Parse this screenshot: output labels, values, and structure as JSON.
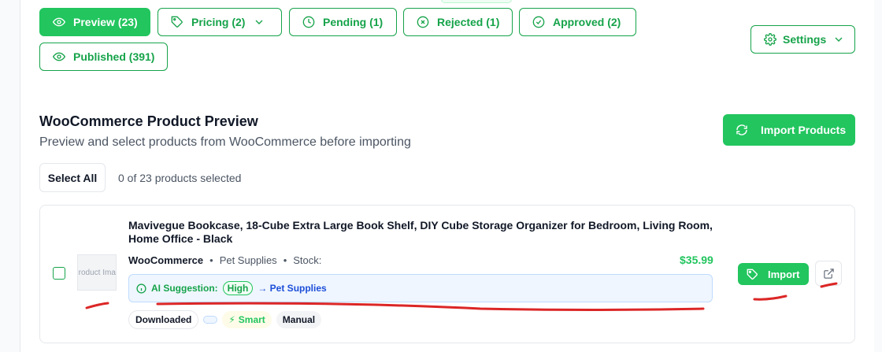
{
  "filters": {
    "preview": "Preview (23)",
    "pricing": "Pricing (2)",
    "pending": "Pending (1)",
    "rejected": "Rejected (1)",
    "approved": "Approved (2)",
    "published": "Published (391)"
  },
  "settings_label": "Settings",
  "section": {
    "title": "WooCommerce Product Preview",
    "subtitle": "Preview and select products from WooCommerce before importing",
    "import_all_label": "Import Products",
    "select_all_label": "Select All",
    "selection_status": "0 of 23 products selected"
  },
  "product": {
    "title": "Mavivegue Bookcase, 18-Cube Extra Large Book Shelf, DIY Cube Storage Organizer for Bedroom, Living Room, Home Office - Black",
    "image_alt": "Product Image",
    "source": "WooCommerce",
    "category": "Pet Supplies",
    "stock_label": "Stock:",
    "price": "$35.99",
    "ai_label": "AI Suggestion:",
    "ai_level": "High",
    "ai_category": "→ Pet Supplies",
    "tags": {
      "downloaded": "Downloaded",
      "smart": "Smart",
      "manual": "Manual"
    },
    "import_label": "Import"
  },
  "colors": {
    "accent": "#22c55e",
    "accent_dark": "#16a34a",
    "annotation": "#dc2626"
  },
  "icons": [
    "eye-icon",
    "tag-icon",
    "chevron-down-icon",
    "clock-icon",
    "x-circle-icon",
    "check-circle-icon",
    "gear-icon",
    "refresh-icon",
    "info-icon",
    "bolt-icon",
    "external-link-icon"
  ]
}
